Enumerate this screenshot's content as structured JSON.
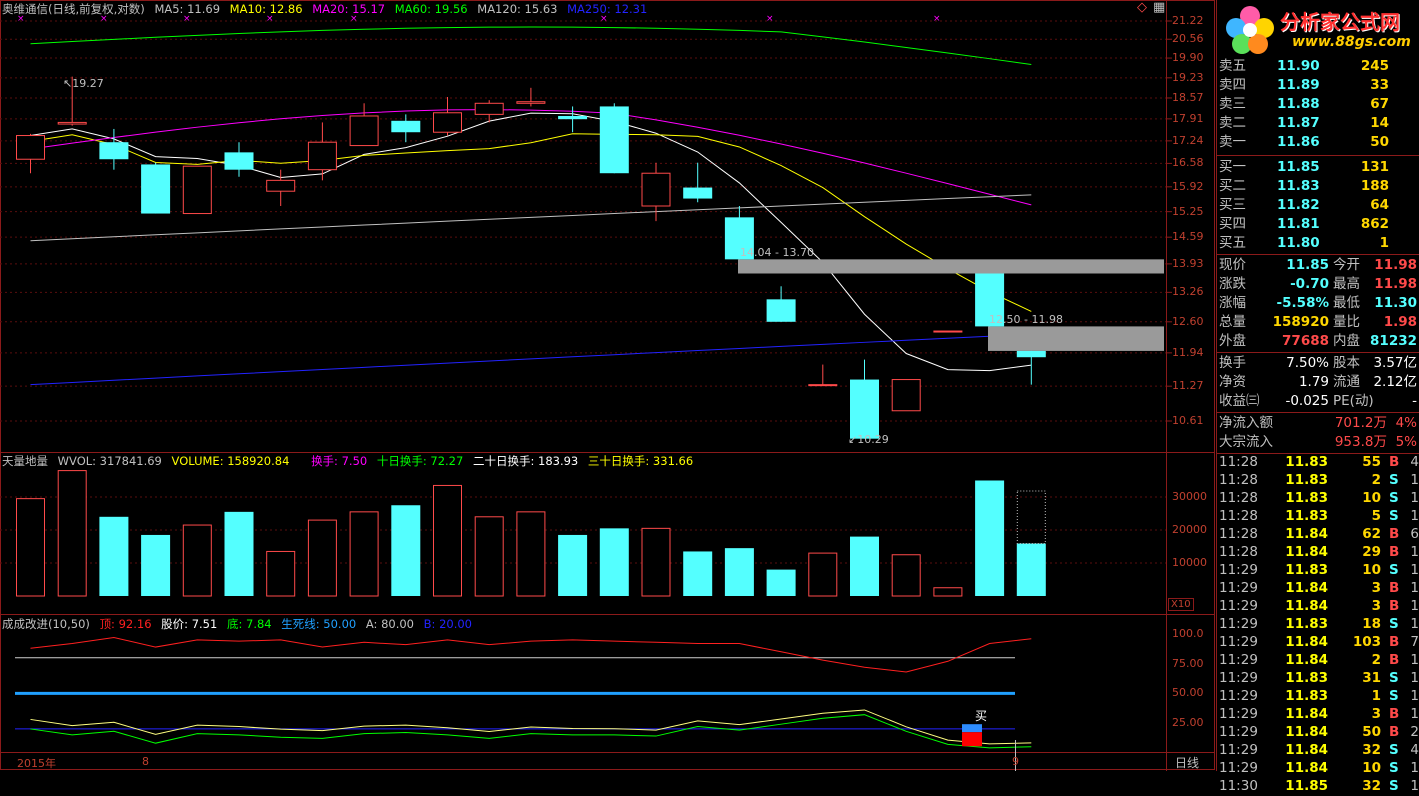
{
  "chart_title": {
    "name": "奥维通信(日线,前复权,对数)",
    "ma5": "MA5: 11.69",
    "ma10": "MA10: 12.86",
    "ma20": "MA20: 15.17",
    "ma60": "MA60: 19.56",
    "ma120": "MA120: 15.63",
    "ma250": "MA250: 12.31"
  },
  "colors": {
    "up": "#ff4a4a",
    "down": "#54ffff",
    "ma5": "#ffffff",
    "ma10": "#ffff00",
    "ma20": "#ff00ff",
    "ma60": "#00ff00",
    "ma120": "#c0c0c0",
    "ma250": "#2323ff"
  },
  "price_axis": [
    "21.22",
    "20.56",
    "19.90",
    "19.23",
    "18.57",
    "17.91",
    "17.24",
    "16.58",
    "15.92",
    "15.25",
    "14.59",
    "13.93",
    "13.26",
    "12.60",
    "11.94",
    "11.27",
    "10.61"
  ],
  "price_annotations": {
    "high": "19.27",
    "low": "10.29",
    "gap1": "14.04 - 13.70",
    "gap2": "12.50 - 11.98"
  },
  "vol_header": {
    "name": "天量地量",
    "wvol": "WVOL: 317841.69",
    "volume": "VOLUME: 158920.84",
    "hs": "换手: 7.50",
    "hs10": "十日换手: 72.27",
    "hs20": "二十日换手: 183.93",
    "hs30": "三十日换手: 331.66"
  },
  "vol_axis": [
    "30000",
    "20000",
    "10000"
  ],
  "vol_unit": "X10",
  "ind_header": {
    "name": "成成改进(10,50)",
    "top": "顶: 92.16",
    "price": "股价: 7.51",
    "bottom": "底: 7.84",
    "life": "生死线: 50.00",
    "a": "A: 80.00",
    "b": "B: 20.00"
  },
  "ind_axis": [
    "100.0",
    "75.00",
    "50.00",
    "25.00"
  ],
  "buy_mark": "买",
  "date_labels": {
    "year": "2015年",
    "m8": "8",
    "m9": "9"
  },
  "period_button": "日线",
  "logo": {
    "title": "分析家公式网",
    "url": "www.88gs.com"
  },
  "asks": [
    {
      "label": "卖五",
      "price": "11.90",
      "vol": "245"
    },
    {
      "label": "卖四",
      "price": "11.89",
      "vol": "33"
    },
    {
      "label": "卖三",
      "price": "11.88",
      "vol": "67"
    },
    {
      "label": "卖二",
      "price": "11.87",
      "vol": "14"
    },
    {
      "label": "卖一",
      "price": "11.86",
      "vol": "50"
    }
  ],
  "bids": [
    {
      "label": "买一",
      "price": "11.85",
      "vol": "131"
    },
    {
      "label": "买二",
      "price": "11.83",
      "vol": "188"
    },
    {
      "label": "买三",
      "price": "11.82",
      "vol": "64"
    },
    {
      "label": "买四",
      "price": "11.81",
      "vol": "862"
    },
    {
      "label": "买五",
      "price": "11.80",
      "vol": "1"
    }
  ],
  "stats": [
    {
      "l1": "现价",
      "v1": "11.85",
      "c1": "#54ffff",
      "l2": "今开",
      "v2": "11.98",
      "c2": "#ff4a4a"
    },
    {
      "l1": "涨跌",
      "v1": "-0.70",
      "c1": "#54ffff",
      "l2": "最高",
      "v2": "11.98",
      "c2": "#ff4a4a"
    },
    {
      "l1": "涨幅",
      "v1": "-5.58%",
      "c1": "#54ffff",
      "l2": "最低",
      "v2": "11.30",
      "c2": "#54ffff"
    },
    {
      "l1": "总量",
      "v1": "158920",
      "c1": "#ffd700",
      "l2": "量比",
      "v2": "1.98",
      "c2": "#ff4a4a"
    },
    {
      "l1": "外盘",
      "v1": "77688",
      "c1": "#ff4a4a",
      "l2": "内盘",
      "v2": "81232",
      "c2": "#54ffff"
    }
  ],
  "stats2": [
    {
      "l1": "换手",
      "v1": "7.50%",
      "l2": "股本",
      "v2": "3.57亿"
    },
    {
      "l1": "净资",
      "v1": "1.79",
      "l2": "流通",
      "v2": "2.12亿"
    },
    {
      "l1": "收益㈢",
      "v1": "-0.025",
      "l2": "PE(动)",
      "v2": "-"
    }
  ],
  "flows": [
    {
      "label": "净流入额",
      "value": "701.2万",
      "pct": "4%"
    },
    {
      "label": "大宗流入",
      "value": "953.8万",
      "pct": "5%"
    }
  ],
  "ticks": [
    {
      "time": "11:28",
      "price": "11.83",
      "vol": "55",
      "side": "B",
      "n": "4"
    },
    {
      "time": "11:28",
      "price": "11.83",
      "vol": "2",
      "side": "S",
      "n": "1"
    },
    {
      "time": "11:28",
      "price": "11.83",
      "vol": "10",
      "side": "S",
      "n": "1"
    },
    {
      "time": "11:28",
      "price": "11.83",
      "vol": "5",
      "side": "S",
      "n": "1"
    },
    {
      "time": "11:28",
      "price": "11.84",
      "vol": "62",
      "side": "B",
      "n": "6"
    },
    {
      "time": "11:28",
      "price": "11.84",
      "vol": "29",
      "side": "B",
      "n": "1"
    },
    {
      "time": "11:29",
      "price": "11.83",
      "vol": "10",
      "side": "S",
      "n": "1"
    },
    {
      "time": "11:29",
      "price": "11.84",
      "vol": "3",
      "side": "B",
      "n": "1"
    },
    {
      "time": "11:29",
      "price": "11.84",
      "vol": "3",
      "side": "B",
      "n": "1"
    },
    {
      "time": "11:29",
      "price": "11.83",
      "vol": "18",
      "side": "S",
      "n": "1"
    },
    {
      "time": "11:29",
      "price": "11.84",
      "vol": "103",
      "side": "B",
      "n": "7"
    },
    {
      "time": "11:29",
      "price": "11.84",
      "vol": "2",
      "side": "B",
      "n": "1"
    },
    {
      "time": "11:29",
      "price": "11.83",
      "vol": "31",
      "side": "S",
      "n": "1"
    },
    {
      "time": "11:29",
      "price": "11.83",
      "vol": "1",
      "side": "S",
      "n": "1"
    },
    {
      "time": "11:29",
      "price": "11.84",
      "vol": "3",
      "side": "B",
      "n": "1"
    },
    {
      "time": "11:29",
      "price": "11.84",
      "vol": "50",
      "side": "B",
      "n": "2"
    },
    {
      "time": "11:29",
      "price": "11.84",
      "vol": "32",
      "side": "S",
      "n": "4"
    },
    {
      "time": "11:29",
      "price": "11.84",
      "vol": "10",
      "side": "S",
      "n": "1"
    },
    {
      "time": "11:30",
      "price": "11.85",
      "vol": "32",
      "side": "S",
      "n": "1"
    }
  ],
  "chart_data": {
    "type": "candlestick",
    "candles": [
      {
        "o": 16.7,
        "c": 17.4,
        "h": 17.45,
        "l": 16.3
      },
      {
        "o": 17.75,
        "c": 17.8,
        "h": 19.27,
        "l": 17.7
      },
      {
        "o": 17.2,
        "c": 16.7,
        "h": 17.6,
        "l": 16.4
      },
      {
        "o": 16.55,
        "c": 15.2,
        "h": 16.6,
        "l": 15.2
      },
      {
        "o": 15.2,
        "c": 16.5,
        "h": 16.5,
        "l": 15.2
      },
      {
        "o": 16.9,
        "c": 16.4,
        "h": 17.2,
        "l": 16.2
      },
      {
        "o": 15.8,
        "c": 16.1,
        "h": 16.4,
        "l": 15.4
      },
      {
        "o": 16.4,
        "c": 17.2,
        "h": 17.8,
        "l": 16.1
      },
      {
        "o": 17.1,
        "c": 18.0,
        "h": 18.4,
        "l": 17.1
      },
      {
        "o": 17.85,
        "c": 17.5,
        "h": 18.05,
        "l": 17.2
      },
      {
        "o": 17.5,
        "c": 18.1,
        "h": 18.6,
        "l": 17.4
      },
      {
        "o": 18.05,
        "c": 18.4,
        "h": 18.5,
        "l": 17.8
      },
      {
        "o": 18.4,
        "c": 18.45,
        "h": 18.9,
        "l": 18.3
      },
      {
        "o": 18.0,
        "c": 17.9,
        "h": 18.3,
        "l": 17.5
      },
      {
        "o": 18.3,
        "c": 16.3,
        "h": 18.4,
        "l": 16.3
      },
      {
        "o": 15.4,
        "c": 16.3,
        "h": 16.6,
        "l": 15.0
      },
      {
        "o": 15.9,
        "c": 15.6,
        "h": 16.6,
        "l": 15.5
      },
      {
        "o": 15.1,
        "c": 14.04,
        "h": 15.4,
        "l": 14.04
      },
      {
        "o": 13.1,
        "c": 12.6,
        "h": 13.4,
        "l": 12.6
      },
      {
        "o": 11.3,
        "c": 11.3,
        "h": 11.7,
        "l": 11.3
      },
      {
        "o": 11.4,
        "c": 10.29,
        "h": 11.8,
        "l": 10.29
      },
      {
        "o": 10.8,
        "c": 11.4,
        "h": 11.4,
        "l": 10.8
      },
      {
        "o": 12.4,
        "c": 12.4,
        "h": 12.4,
        "l": 12.4
      },
      {
        "o": 13.7,
        "c": 12.5,
        "h": 13.7,
        "l": 12.5
      },
      {
        "o": 11.98,
        "c": 11.85,
        "h": 11.98,
        "l": 11.3
      }
    ],
    "volume": [
      29500,
      38000,
      24000,
      18500,
      21500,
      25500,
      13500,
      23000,
      25500,
      27500,
      33500,
      24000,
      25500,
      18500,
      20500,
      20500,
      13500,
      14500,
      8000,
      13000,
      18000,
      12500,
      2500,
      35000,
      15892
    ],
    "ind_top": [
      88,
      92,
      97,
      89,
      95,
      94,
      95,
      89,
      93,
      91,
      95,
      91,
      94,
      95,
      94,
      93,
      92,
      92,
      85,
      78,
      72,
      68,
      77,
      92,
      96
    ],
    "ind_bottom": [
      20,
      15,
      18,
      8,
      16,
      15,
      13,
      12,
      16,
      17,
      15,
      12,
      16,
      15,
      15,
      14,
      22,
      19,
      24,
      29,
      32,
      18,
      7,
      4,
      5
    ]
  }
}
